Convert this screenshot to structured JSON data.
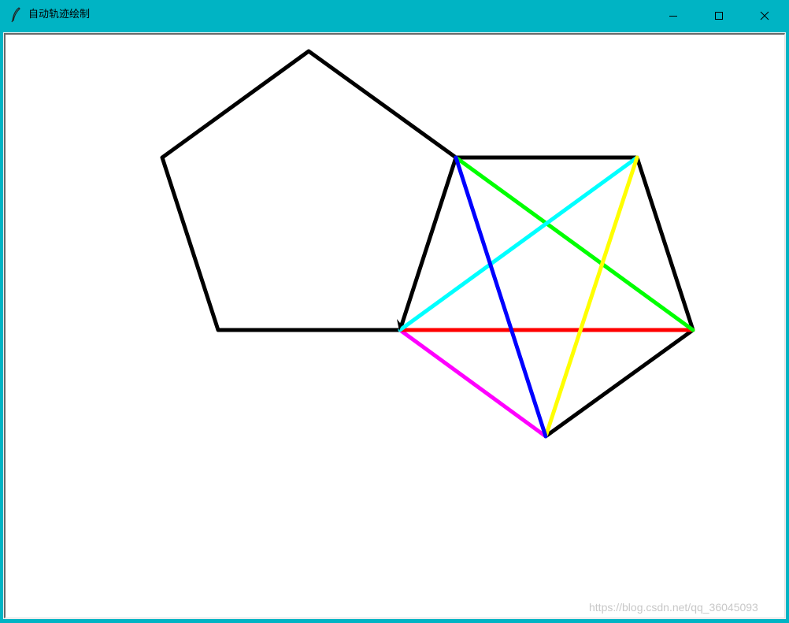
{
  "window": {
    "title": "自动轨迹绘制",
    "icon": "feather-icon",
    "controls": [
      "minimize-icon",
      "maximize-icon",
      "close-icon"
    ]
  },
  "colors": {
    "titlebar": "#00b4c4",
    "canvas": "#ffffff",
    "stroke_default": "#000000"
  },
  "drawing": {
    "pen": "black",
    "segments": [
      {
        "name": "black",
        "color": "#000000"
      },
      {
        "name": "green",
        "color": "#00ff00"
      },
      {
        "name": "cyan",
        "color": "#00ffff"
      },
      {
        "name": "yellow",
        "color": "#ffff00"
      },
      {
        "name": "blue",
        "color": "#0000ff"
      },
      {
        "name": "magenta",
        "color": "#ff00ff"
      },
      {
        "name": "red",
        "color": "#ff0000"
      }
    ]
  },
  "watermark": "https://blog.csdn.net/qq_36045093"
}
